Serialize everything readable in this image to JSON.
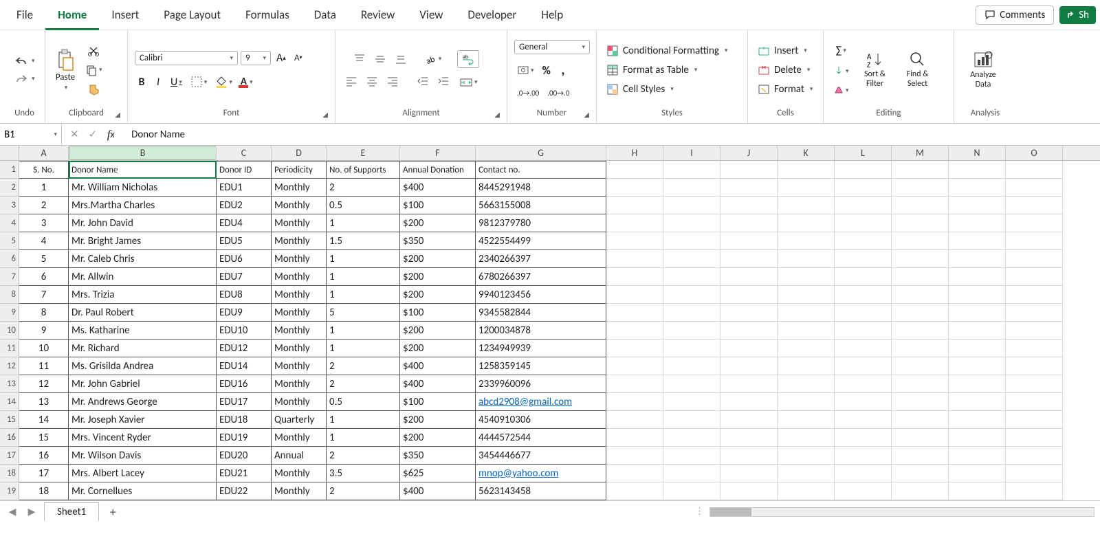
{
  "menu": [
    "File",
    "Home",
    "Insert",
    "Page Layout",
    "Formulas",
    "Data",
    "Review",
    "View",
    "Developer",
    "Help"
  ],
  "menu_active": 1,
  "header_actions": {
    "comments": "Comments",
    "share": "Sh"
  },
  "ribbon": {
    "undo": "Undo",
    "clipboard": {
      "paste": "Paste",
      "label": "Clipboard"
    },
    "font": {
      "name": "Calibri",
      "size": "9",
      "label": "Font"
    },
    "alignment": "Alignment",
    "number": {
      "format": "General",
      "label": "Number"
    },
    "styles": {
      "cond": "Conditional Formatting",
      "tbl": "Format as Table",
      "cell": "Cell Styles",
      "label": "Styles"
    },
    "cells": {
      "insert": "Insert",
      "delete": "Delete",
      "format": "Format",
      "label": "Cells"
    },
    "editing": {
      "sort": "Sort & Filter",
      "find": "Find & Select",
      "label": "Editing"
    },
    "analysis": {
      "btn": "Analyze Data",
      "label": "Analysis"
    }
  },
  "formula_bar": {
    "cell_ref": "B1",
    "value": "Donor Name"
  },
  "columns_visible": [
    "A",
    "B",
    "C",
    "D",
    "E",
    "F",
    "G",
    "H",
    "I",
    "J",
    "K",
    "L",
    "M",
    "N",
    "O"
  ],
  "selected_col": "B",
  "col_widths": {
    "A": 72,
    "B": 215,
    "C": 80,
    "D": 80,
    "E": 107,
    "F": 110,
    "G": 190,
    "_rest": 83
  },
  "row_h_start": 1,
  "table": {
    "headers": [
      "S. No.",
      "Donor Name",
      "Donor ID",
      "Periodicity",
      "No. of Supports",
      "Annual Donation",
      "Contact no."
    ],
    "rows": [
      [
        "1",
        "Mr. William Nicholas",
        "EDU1",
        "Monthly",
        "2",
        "$400",
        "8445291948"
      ],
      [
        "2",
        "Mrs.Martha Charles",
        "EDU2",
        "Monthly",
        "0.5",
        "$100",
        "5663155008"
      ],
      [
        "3",
        "Mr. John David",
        "EDU4",
        "Monthly",
        "1",
        "$200",
        "9812379780"
      ],
      [
        "4",
        "Mr. Bright James",
        "EDU5",
        "Monthly",
        "1.5",
        "$350",
        "4522554499"
      ],
      [
        "5",
        "Mr. Caleb Chris",
        "EDU6",
        "Monthly",
        "1",
        "$200",
        "2340266397"
      ],
      [
        "6",
        "Mr. Allwin",
        "EDU7",
        "Monthly",
        "1",
        "$200",
        "6780266397"
      ],
      [
        "7",
        "Mrs. Trizia",
        "EDU8",
        "Monthly",
        "1",
        "$200",
        "9940123456"
      ],
      [
        "8",
        "Dr. Paul Robert",
        "EDU9",
        "Monthly",
        "5",
        "$100",
        "9345582844"
      ],
      [
        "9",
        "Ms. Katharine",
        "EDU10",
        "Monthly",
        "1",
        "$200",
        "1200034878"
      ],
      [
        "10",
        "Mr. Richard",
        "EDU12",
        "Monthly",
        "1",
        "$200",
        "1234949939"
      ],
      [
        "11",
        "Ms. Grisilda Andrea",
        "EDU14",
        "Monthly",
        "2",
        "$400",
        "1258359145"
      ],
      [
        "12",
        "Mr. John Gabriel",
        "EDU16",
        "Monthly",
        "2",
        "$400",
        "2339960096"
      ],
      [
        "13",
        "Mr. Andrews George",
        "EDU17",
        "Monthly",
        "0.5",
        "$100",
        "abcd2908@gmail.com"
      ],
      [
        "14",
        "Mr. Joseph Xavier",
        "EDU18",
        "Quarterly",
        "1",
        "$200",
        "4540910306"
      ],
      [
        "15",
        "Mrs. Vincent Ryder",
        "EDU19",
        "Monthly",
        "1",
        "$200",
        "4444572544"
      ],
      [
        "16",
        "Mr. Wilson Davis",
        "EDU20",
        "Annual",
        "2",
        "$350",
        "3454446677"
      ],
      [
        "17",
        "Mrs. Albert Lacey",
        "EDU21",
        "Monthly",
        "3.5",
        "$625",
        "mnop@yahoo.com"
      ],
      [
        "18",
        "Mr. Cornellues",
        "EDU22",
        "Monthly",
        "2",
        "$400",
        "5623143458"
      ]
    ],
    "link_rows": [
      12,
      16
    ]
  },
  "sheet": {
    "name": "Sheet1"
  }
}
